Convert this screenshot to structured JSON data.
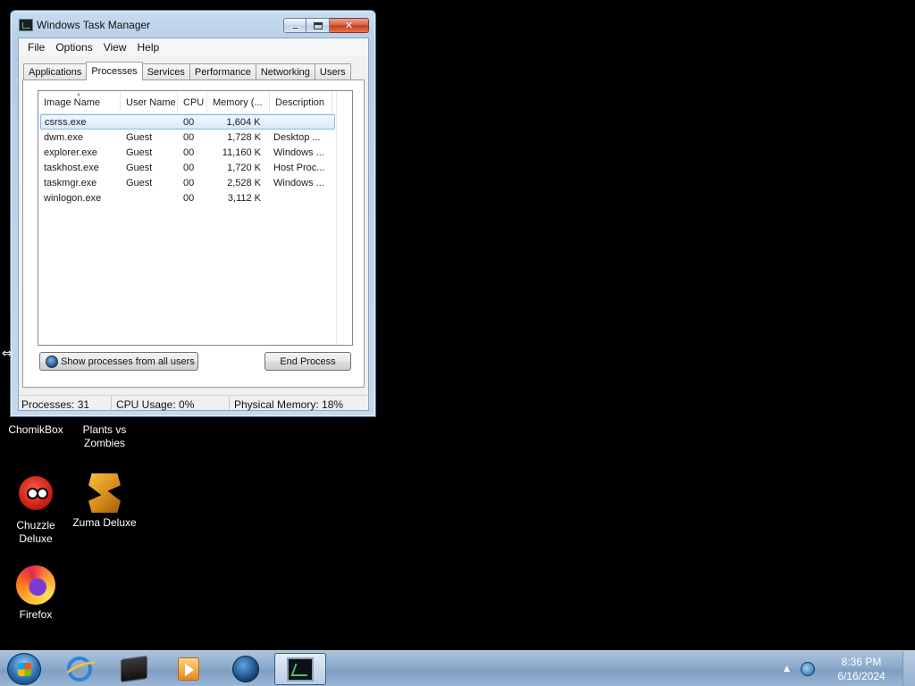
{
  "window": {
    "title": "Windows Task Manager",
    "menu": [
      "File",
      "Options",
      "View",
      "Help"
    ],
    "tabs": [
      "Applications",
      "Processes",
      "Services",
      "Performance",
      "Networking",
      "Users"
    ],
    "active_tab": "Processes",
    "columns": [
      "Image Name",
      "User Name",
      "CPU",
      "Memory (...",
      "Description"
    ],
    "rows": [
      {
        "image": "csrss.exe",
        "user": "",
        "cpu": "00",
        "memory": "1,604 K",
        "desc": ""
      },
      {
        "image": "dwm.exe",
        "user": "Guest",
        "cpu": "00",
        "memory": "1,728 K",
        "desc": "Desktop ..."
      },
      {
        "image": "explorer.exe",
        "user": "Guest",
        "cpu": "00",
        "memory": "11,160 K",
        "desc": "Windows ..."
      },
      {
        "image": "taskhost.exe",
        "user": "Guest",
        "cpu": "00",
        "memory": "1,720 K",
        "desc": "Host Proc..."
      },
      {
        "image": "taskmgr.exe",
        "user": "Guest",
        "cpu": "00",
        "memory": "2,528 K",
        "desc": "Windows ..."
      },
      {
        "image": "winlogon.exe",
        "user": "",
        "cpu": "00",
        "memory": "3,112 K",
        "desc": ""
      }
    ],
    "selected_row": 0,
    "show_all_label": "Show processes from all users",
    "end_process_label": "End Process",
    "status": {
      "processes": "Processes: 31",
      "cpu": "CPU Usage: 0%",
      "memory": "Physical Memory: 18%"
    }
  },
  "desktop_icons": [
    {
      "label": "ChomikBox",
      "icon": "chomikbox-icon"
    },
    {
      "label": "Plants vs Zombies",
      "icon": "plants-vs-zombies-icon"
    },
    {
      "label": "Chuzzle Deluxe",
      "icon": "chuzzle-icon"
    },
    {
      "label": "Zuma Deluxe",
      "icon": "zuma-icon"
    },
    {
      "label": "Firefox",
      "icon": "firefox-icon"
    }
  ],
  "taskbar": {
    "pinned": [
      "internet-explorer-icon",
      "chomikbox-icon",
      "media-player-icon",
      "globe-icon",
      "task-manager-icon"
    ],
    "active": "task-manager-icon",
    "clock_time": "8:36 PM",
    "clock_date": "6/16/2024"
  }
}
